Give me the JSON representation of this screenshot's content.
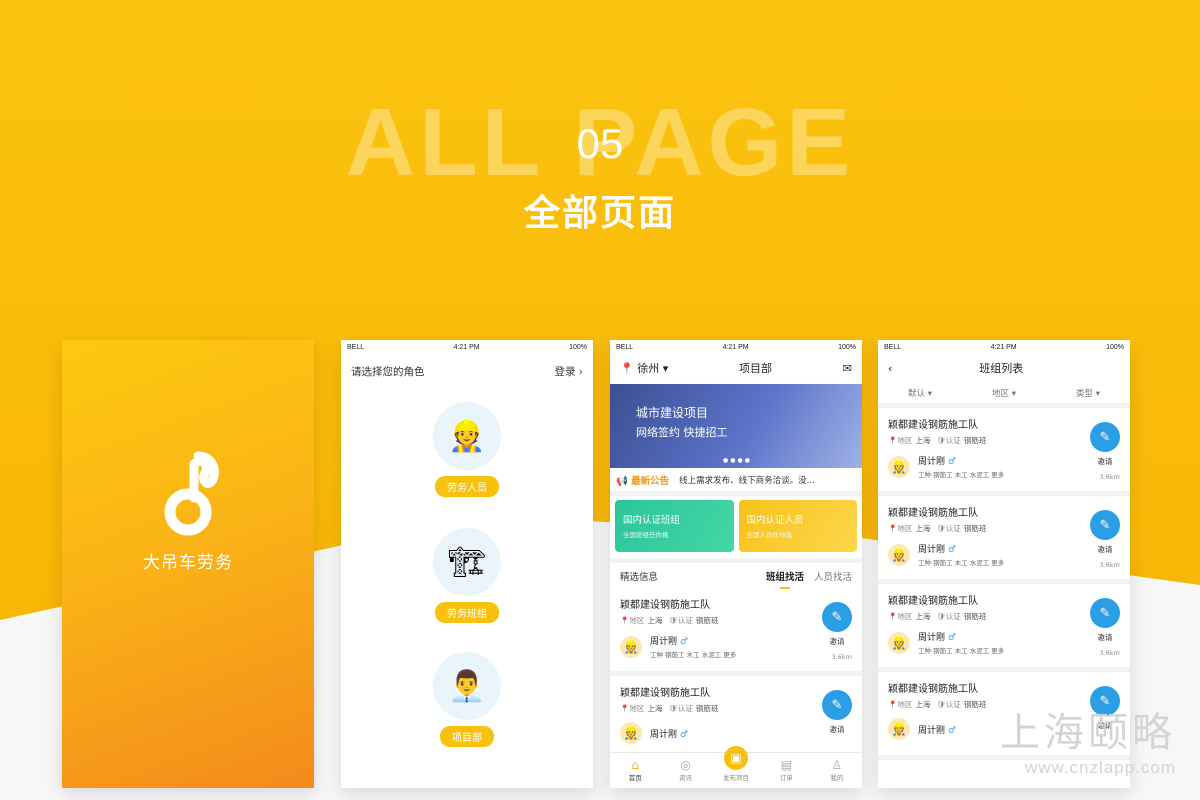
{
  "hero": {
    "big": "ALL PAGE",
    "num": "05",
    "cn": "全部页面"
  },
  "status": {
    "carrier": "BELL",
    "time": "4:21 PM",
    "battery": "100%"
  },
  "splash": {
    "app_name": "大吊车劳务"
  },
  "role_page": {
    "title": "请选择您的角色",
    "login": "登录",
    "roles": [
      "劳务人员",
      "劳务班组",
      "项目部"
    ]
  },
  "home": {
    "city": "徐州",
    "title": "项目部",
    "banner_l1": "城市建设项目",
    "banner_l2": "网络签约  快捷招工",
    "notice_tag": "最新公告",
    "notice_text": "线上需求发布、线下商务洽谈。没...",
    "card1_t": "国内认证班组",
    "card1_s": "全国班组任你挑",
    "card2_t": "国内认证人员",
    "card2_s": "全国人员任你选",
    "sel_title": "精选信息",
    "tab_a": "班组找活",
    "tab_b": "人员找活",
    "tabs": [
      "首页",
      "资讯",
      "发布项目",
      "订单",
      "我的"
    ]
  },
  "team": {
    "name": "颖都建设钢筋施工队",
    "region_label": "地区",
    "region": "上海",
    "cert_label": "认证",
    "cert": "钢筋班",
    "person": "周计刚",
    "gender": "♂",
    "worker_label": "工种",
    "skills": "钢筋工  木工  水泥工  更多",
    "invite": "邀请",
    "dist": "3.6km"
  },
  "list_page": {
    "title": "班组列表",
    "filters": [
      "默认",
      "地区",
      "类型"
    ]
  },
  "watermark": {
    "cn": "上海颐略",
    "url": "www.cnzlapp.com"
  },
  "colors": {
    "brand_yellow": "#f9c10f",
    "blue": "#2b9ee6",
    "green": "#2bc59b"
  }
}
